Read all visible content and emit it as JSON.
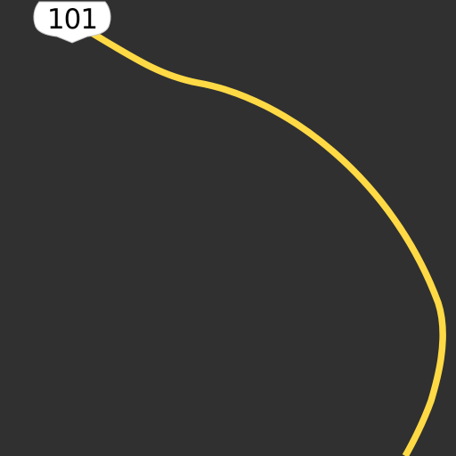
{
  "map": {
    "background_color": "#303030",
    "road": {
      "name": "US-101",
      "color": "#FFDA45",
      "shield_label": "101",
      "shield_icon": "us-highway-shield-icon"
    }
  }
}
